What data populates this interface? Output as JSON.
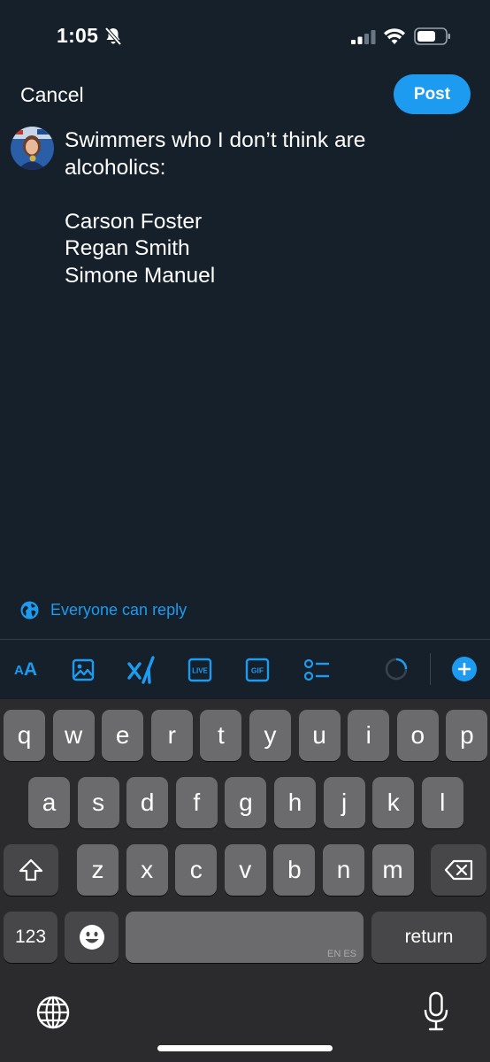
{
  "status_bar": {
    "time": "1:05"
  },
  "composer": {
    "cancel_label": "Cancel",
    "post_label": "Post",
    "text": "Swimmers who I don’t think are\nalcoholics:\n\nCarson Foster\nRegan Smith\nSimone Manuel",
    "reply_setting": "Everyone can reply"
  },
  "toolbar": {
    "items": [
      "text-format",
      "image",
      "grok",
      "live",
      "gif",
      "poll",
      "character-progress",
      "add-post"
    ],
    "text_format_label_small": "A",
    "text_format_label_large": "A",
    "live_label": "LIVE",
    "gif_label": "GIF"
  },
  "keyboard": {
    "row1": [
      "q",
      "w",
      "e",
      "r",
      "t",
      "y",
      "u",
      "i",
      "o",
      "p"
    ],
    "row2": [
      "a",
      "s",
      "d",
      "f",
      "g",
      "h",
      "j",
      "k",
      "l"
    ],
    "row3": [
      "z",
      "x",
      "c",
      "v",
      "b",
      "n",
      "m"
    ],
    "numbers_label": "123",
    "return_label": "return",
    "space_hint": "EN ES"
  },
  "colors": {
    "background": "#15202b",
    "accent": "#1d9bf0",
    "keyboard_bg": "#2b2b2d",
    "key_bg": "#6b6b6e",
    "key_dark_bg": "#474749"
  }
}
